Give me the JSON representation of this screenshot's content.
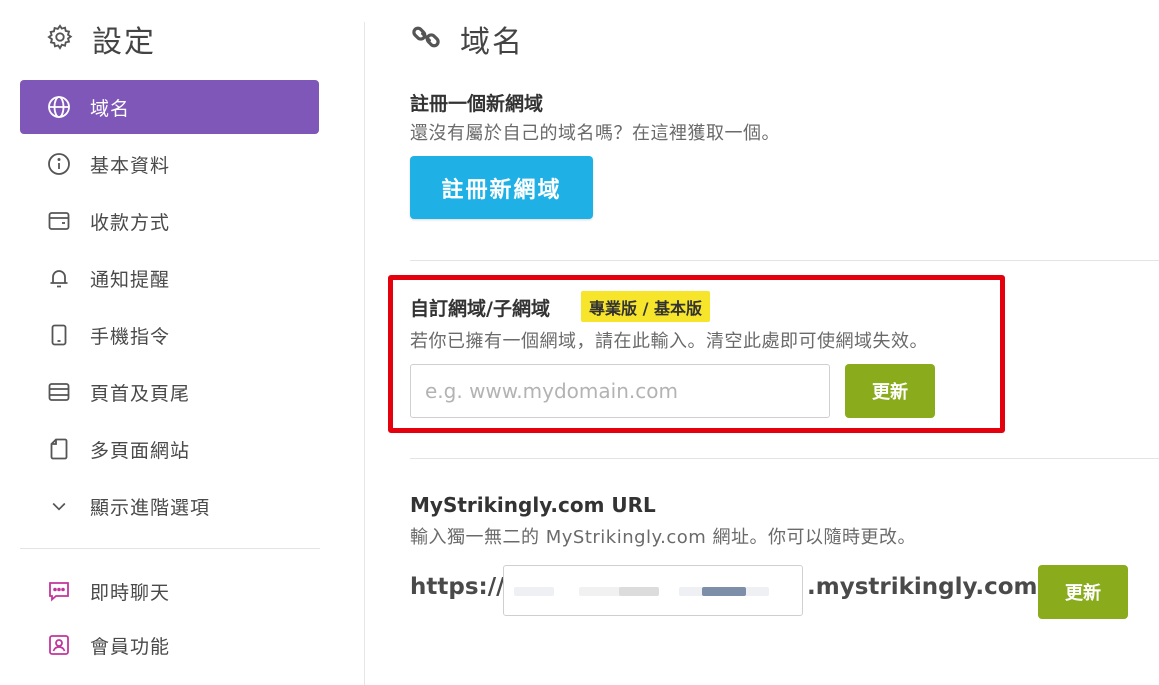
{
  "sidebar": {
    "title": "設定",
    "items": [
      {
        "label": "域名",
        "icon": "globe-icon",
        "active": true
      },
      {
        "label": "基本資料",
        "icon": "info-icon"
      },
      {
        "label": "收款方式",
        "icon": "wallet-icon"
      },
      {
        "label": "通知提醒",
        "icon": "bell-icon"
      },
      {
        "label": "手機指令",
        "icon": "mobile-icon"
      },
      {
        "label": "頁首及頁尾",
        "icon": "layout-icon"
      },
      {
        "label": "多頁面網站",
        "icon": "page-icon"
      },
      {
        "label": "顯示進階選項",
        "icon": "chevron-down-icon"
      },
      {
        "label": "即時聊天",
        "icon": "chat-icon"
      },
      {
        "label": "會員功能",
        "icon": "member-icon"
      }
    ]
  },
  "main": {
    "title": "域名",
    "title_icon": "link-icon",
    "register": {
      "heading": "註冊一個新網域",
      "description": "還沒有屬於自己的域名嗎？在這裡獲取一個。",
      "button_label": "註冊新網域"
    },
    "custom_domain": {
      "heading": "自訂網域/子網域",
      "badge": "專業版 / 基本版",
      "description": "若你已擁有一個網域，請在此輸入。清空此處即可使網域失效。",
      "placeholder": "e.g. www.mydomain.com",
      "button_label": "更新"
    },
    "strikingly_url": {
      "heading": "MyStrikingly.com URL",
      "description": "輸入獨一無二的 MyStrikingly.com 網址。你可以隨時更改。",
      "prefix": "https://",
      "suffix": ".mystrikingly.com",
      "button_label": "更新"
    }
  },
  "colors": {
    "active_nav": "#7f57b9",
    "register_button": "#1fb1e6",
    "update_button": "#8aac1c",
    "highlight_border": "#e4000d",
    "badge": "#f6e52a",
    "pink_icon": "#c2369c"
  }
}
